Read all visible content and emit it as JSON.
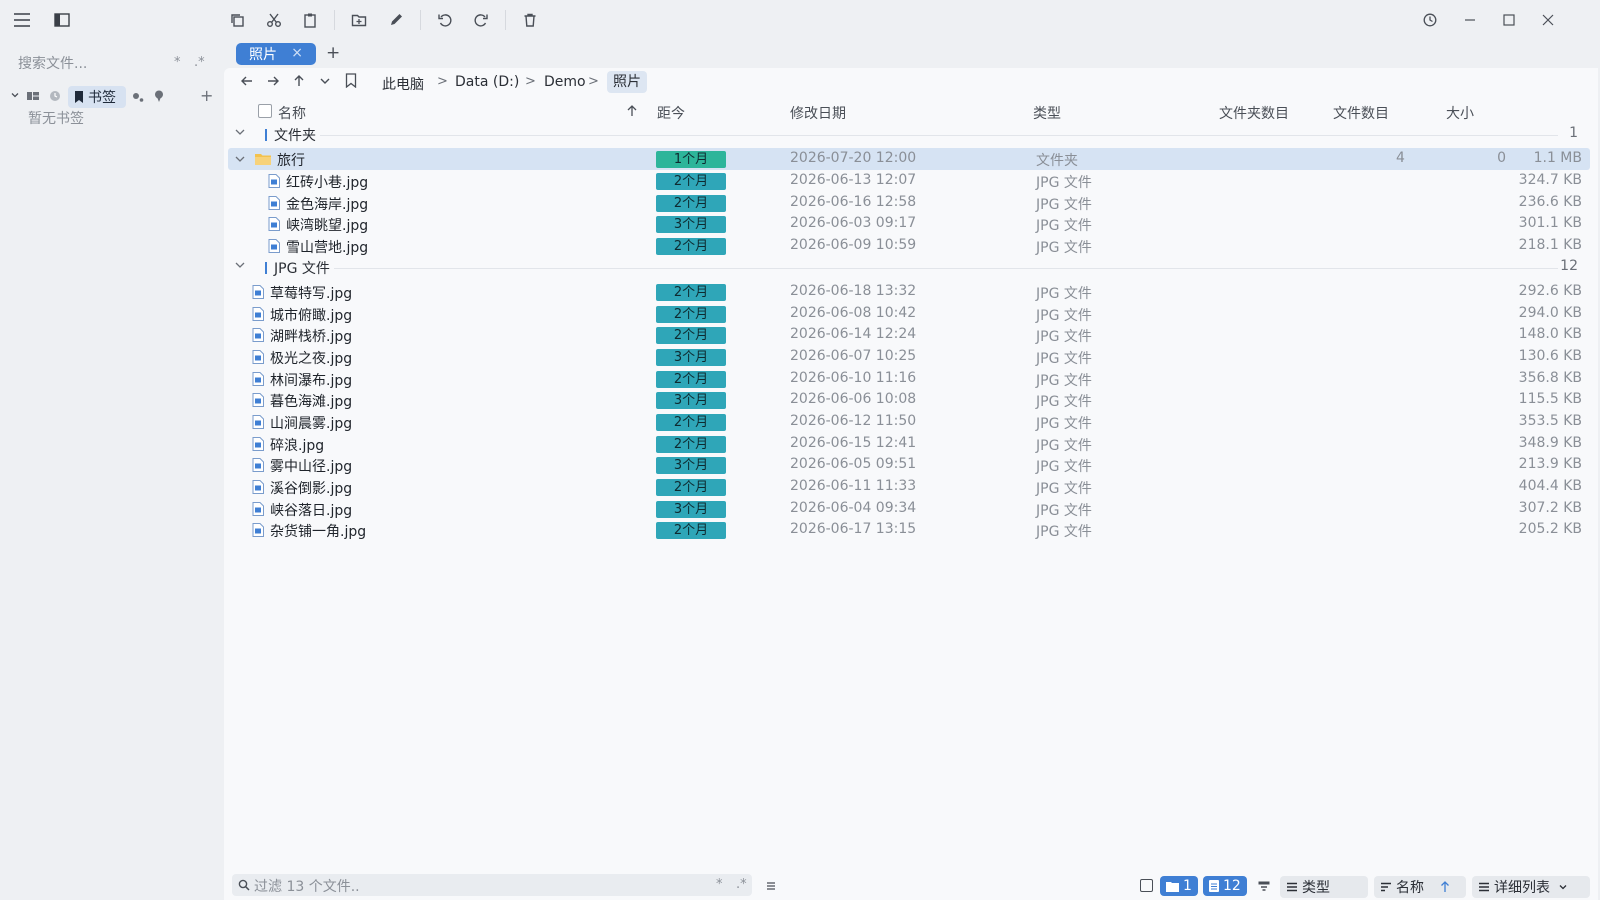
{
  "colors": {
    "accent": "#3f7fd4",
    "badge": "#2fa6b8",
    "badge_recent": "#2db59a",
    "selected_row": "#d6e3f3"
  },
  "sidebar": {
    "search_placeholder": "搜索文件...",
    "regex_star": "*",
    "regex_dotstar": ".*",
    "bookmarks_label": "书签",
    "empty_text": "暂无书签",
    "add_symbol": "+"
  },
  "tab": {
    "label": "照片",
    "close": "×",
    "add": "+"
  },
  "breadcrumb": [
    "此电脑",
    "Data (D:)",
    "Demo",
    "照片"
  ],
  "breadcrumb_sep": ">",
  "columns": {
    "name": "名称",
    "age": "距今",
    "modified": "修改日期",
    "type": "类型",
    "folder_count": "文件夹数目",
    "file_count": "文件数目",
    "size": "大小"
  },
  "groups": {
    "folders": {
      "label": "文件夹",
      "count": "1"
    },
    "jpg": {
      "label": "JPG 文件",
      "count": "12"
    }
  },
  "folder": {
    "name": "旅行",
    "age": "1个月",
    "modified": "2026-07-20 12:00",
    "type": "文件夹",
    "folder_count": "0",
    "file_count": "4",
    "size": "1.1 MB",
    "children": [
      {
        "name": "红砖小巷.jpg",
        "age": "2个月",
        "modified": "2026-06-13 12:07",
        "type": "JPG 文件",
        "size": "324.7 KB"
      },
      {
        "name": "金色海岸.jpg",
        "age": "2个月",
        "modified": "2026-06-16 12:58",
        "type": "JPG 文件",
        "size": "236.6 KB"
      },
      {
        "name": "峡湾眺望.jpg",
        "age": "3个月",
        "modified": "2026-06-03 09:17",
        "type": "JPG 文件",
        "size": "301.1 KB"
      },
      {
        "name": "雪山营地.jpg",
        "age": "2个月",
        "modified": "2026-06-09 10:59",
        "type": "JPG 文件",
        "size": "218.1 KB"
      }
    ]
  },
  "files": [
    {
      "name": "草莓特写.jpg",
      "age": "2个月",
      "modified": "2026-06-18 13:32",
      "type": "JPG 文件",
      "size": "292.6 KB"
    },
    {
      "name": "城市俯瞰.jpg",
      "age": "2个月",
      "modified": "2026-06-08 10:42",
      "type": "JPG 文件",
      "size": "294.0 KB"
    },
    {
      "name": "湖畔栈桥.jpg",
      "age": "2个月",
      "modified": "2026-06-14 12:24",
      "type": "JPG 文件",
      "size": "148.0 KB"
    },
    {
      "name": "极光之夜.jpg",
      "age": "3个月",
      "modified": "2026-06-07 10:25",
      "type": "JPG 文件",
      "size": "130.6 KB"
    },
    {
      "name": "林间瀑布.jpg",
      "age": "2个月",
      "modified": "2026-06-10 11:16",
      "type": "JPG 文件",
      "size": "356.8 KB"
    },
    {
      "name": "暮色海滩.jpg",
      "age": "3个月",
      "modified": "2026-06-06 10:08",
      "type": "JPG 文件",
      "size": "115.5 KB"
    },
    {
      "name": "山涧晨雾.jpg",
      "age": "2个月",
      "modified": "2026-06-12 11:50",
      "type": "JPG 文件",
      "size": "353.5 KB"
    },
    {
      "name": "碎浪.jpg",
      "age": "2个月",
      "modified": "2026-06-15 12:41",
      "type": "JPG 文件",
      "size": "348.9 KB"
    },
    {
      "name": "雾中山径.jpg",
      "age": "3个月",
      "modified": "2026-06-05 09:51",
      "type": "JPG 文件",
      "size": "213.9 KB"
    },
    {
      "name": "溪谷倒影.jpg",
      "age": "2个月",
      "modified": "2026-06-11 11:33",
      "type": "JPG 文件",
      "size": "404.4 KB"
    },
    {
      "name": "峡谷落日.jpg",
      "age": "3个月",
      "modified": "2026-06-04 09:34",
      "type": "JPG 文件",
      "size": "307.2 KB"
    },
    {
      "name": "杂货铺一角.jpg",
      "age": "2个月",
      "modified": "2026-06-17 13:15",
      "type": "JPG 文件",
      "size": "205.2 KB"
    }
  ],
  "statusbar": {
    "filter_placeholder": "过滤 13 个文件..",
    "regex_star": "*",
    "regex_dotstar": ".*",
    "folder_count": "1",
    "file_count": "12",
    "group_by": "类型",
    "sort_by": "名称",
    "view": "详细列表"
  }
}
